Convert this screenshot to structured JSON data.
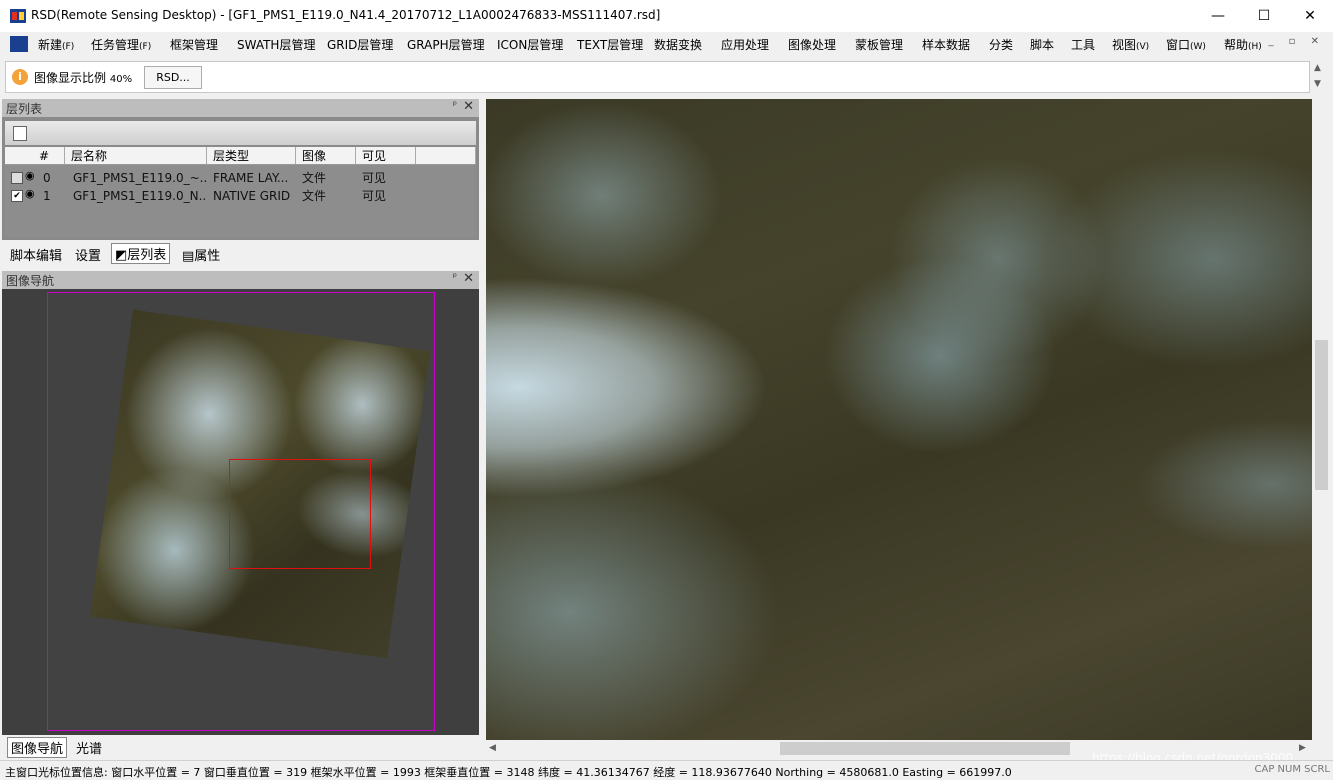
{
  "window": {
    "title": "RSD(Remote Sensing Desktop) - [GF1_PMS1_E119.0_N41.4_20170712_L1A0002476833-MSS111407.rsd]",
    "controls": [
      "—",
      "☐",
      "✕"
    ]
  },
  "menu": {
    "items": [
      {
        "label": "新建",
        "key": "(F)"
      },
      {
        "label": "任务管理",
        "key": "(F)"
      },
      {
        "label": "框架管理",
        "key": ""
      },
      {
        "label": "SWATH层管理",
        "key": ""
      },
      {
        "label": "GRID层管理",
        "key": ""
      },
      {
        "label": "GRAPH层管理",
        "key": ""
      },
      {
        "label": "ICON层管理",
        "key": ""
      },
      {
        "label": "TEXT层管理",
        "key": ""
      },
      {
        "label": "数据变换",
        "key": ""
      },
      {
        "label": "应用处理",
        "key": ""
      },
      {
        "label": "图像处理",
        "key": ""
      },
      {
        "label": "蒙板管理",
        "key": ""
      },
      {
        "label": "样本数据",
        "key": ""
      },
      {
        "label": "分类",
        "key": ""
      },
      {
        "label": "脚本",
        "key": ""
      },
      {
        "label": "工具",
        "key": ""
      },
      {
        "label": "视图",
        "key": "(V)"
      },
      {
        "label": "窗口",
        "key": "(W)"
      },
      {
        "label": "帮助",
        "key": "(H)"
      }
    ],
    "mdi_controls": "_ ▫ ✕"
  },
  "infobar": {
    "label": "图像显示比例",
    "ratio": "40%",
    "button": "RSD..."
  },
  "layers_panel": {
    "title": "层列表",
    "columns": [
      "#",
      "层名称",
      "层类型",
      "图像",
      "可见"
    ],
    "rows": [
      {
        "checked": false,
        "index": "0",
        "name": "GF1_PMS1_E119.0_~...",
        "type": "FRAME LAY...",
        "image": "文件",
        "visible": "可见"
      },
      {
        "checked": true,
        "index": "1",
        "name": "GF1_PMS1_E119.0_N...",
        "type": "NATIVE GRID",
        "image": "文件",
        "visible": "可见"
      }
    ]
  },
  "tabs_top": [
    "脚本编辑",
    "设置",
    "层列表",
    "属性"
  ],
  "nav_panel": {
    "title": "图像导航"
  },
  "tabs_bottom": [
    "图像导航",
    "光谱"
  ],
  "status": {
    "text": "主窗口光标位置信息:   窗口水平位置 = 7 窗口垂直位置 = 319 框架水平位置 = 1993 框架垂直位置 = 3148 纬度  = 41.36134767 经度  = 118.93677640 Northing = 4580681.0 Easting = 661997.0",
    "indicators": "CAP NUM SCRL",
    "watermark": "https://blog.csdn.net/gordon3000"
  }
}
